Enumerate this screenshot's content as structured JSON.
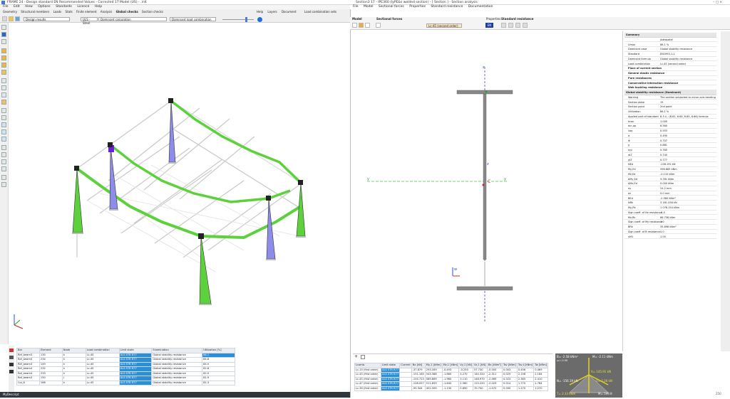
{
  "main_window": {
    "title": "FRAME 24 - Design standard EN Recommended Values - Corrected 17 Model (US) - .iri4",
    "menu": [
      "File",
      "Edit",
      "View",
      "Options",
      "Standards",
      "Licence",
      "Help"
    ],
    "tabs": [
      "Geometry",
      "Structural members",
      "Loads",
      "Stats",
      "Finite element",
      "Analysis",
      "Global checks",
      "Section checks"
    ],
    "right_tabs": [
      "Help",
      "Layers",
      "Document",
      "Load combination sets"
    ],
    "dropdown_design": "Design results",
    "dropdown_uls": "ULS - Steel",
    "dropdown_calc": "Dominant calculation",
    "dropdown_comb": "Dominant load combination"
  },
  "results_table": {
    "headers": [
      "Bar",
      "Element",
      "Node",
      "Load combination",
      "Limit state",
      "Examination",
      "Utilization [%]"
    ],
    "rows": [
      [
        "Raf_beam3",
        "130",
        "k",
        "Lc-45",
        "ULS STR R77",
        "Global stability resistance",
        "86.1"
      ],
      [
        "Raf_beam4",
        "234",
        "k",
        "Lc-45",
        "ULS STR R77",
        "Global stability resistance",
        "84.8"
      ],
      [
        "Raf_beam3",
        "149",
        "k",
        "Lc-45",
        "ULS STR R77",
        "Global stability resistance",
        "84.0"
      ],
      [
        "Raf_beam4",
        "232",
        "k",
        "Lc-45",
        "ULS STR R77",
        "Global stability resistance",
        "82.6"
      ],
      [
        "Raf_beam4",
        "233",
        "k",
        "Lc-45",
        "ULS STR R77",
        "Global stability resistance",
        "82.0"
      ],
      [
        "Raf_beam3",
        "150",
        "j",
        "Lc-45",
        "ULS STR R77",
        "Global stability resistance",
        "81.9"
      ],
      [
        "Col_6",
        "166",
        "k",
        "Lc-45",
        "ULS STR R77",
        "Global stability resistance",
        "81.3"
      ]
    ]
  },
  "statusbar": {
    "label": "MyDescript"
  },
  "section_window": {
    "title": "Section3 17 - IPE360 (IyPE&s welded section) - [ Section ] - Section analysis",
    "menu": [
      "File",
      "Model",
      "Sectional forces",
      "Properties",
      "Standard resistance",
      "Documentation"
    ],
    "tabs": [
      "Model",
      "Sectional forces",
      "Properties",
      "Standard resistance"
    ],
    "combo": "Lc-45 (second order)",
    "standard_button": "EN",
    "axis_labels": {
      "z_top": "z",
      "z_mid": "z",
      "y_left": "y",
      "y_right": "y",
      "centroid": "C",
      "w": "w"
    },
    "forces_table": {
      "headers": [
        "Lcomb.",
        "Limit state",
        "Current",
        "Nx [kN]",
        "My,1 [kNm]",
        "Mz,1 [kNm]",
        "Vy,1 [kN]",
        "Vz,1 [kN]",
        "Bx [kNm²]",
        "Tsv [kNm]",
        "Tsv,t [kNm]",
        "Tw [kNm]"
      ],
      "rows": [
        [
          "Lc-15 (first order)",
          "ULS STR R77",
          "",
          "-37.879",
          "293.349",
          "-0.493",
          "-0.250",
          "57.730",
          "-0.005",
          "0.003",
          "0.456",
          "0.469"
        ],
        [
          "Lc-45 (first order)",
          "ULS STR R77",
          "",
          "-151.185",
          "543.388",
          "-1.860",
          "3.270",
          "144.320",
          "-2.311",
          "0.025",
          "2.158",
          "2.184"
        ],
        [
          "Lc-45 (first order)",
          "ULS STR R77",
          "",
          "-154.723",
          "589.869",
          "-1.960",
          "3.110",
          "148.970",
          "-2.469",
          "0.023",
          "2.365",
          "2.410"
        ],
        [
          "Lc-47 (first order)",
          "ULS STR R77",
          "",
          "-128.057",
          "511.859",
          "-1.640",
          "2.560",
          "115.220",
          "-2.029",
          "0.014",
          "1.770",
          "1.784"
        ],
        [
          "Lc-39 (first order)",
          "ULS STR R77",
          "",
          "-95.344",
          "402.399",
          "-1.130",
          "0.690",
          "70.700",
          "-1.470",
          "0.000",
          "1.270",
          "1.270"
        ]
      ]
    },
    "stress_labels": {
      "tl": "B= -2.58 kNm²",
      "tl2": "ω=-0.50",
      "tr": "M= -2.11 kNm",
      "mid": "V= 145.91 kN",
      "left": "N= -156.19 kN",
      "right": "V= 2.26 kN",
      "bottom_left": "T= 2.33 kNm",
      "bottom_right": "M= 599.9"
    }
  },
  "summary_panel": {
    "summary_header": "Summary",
    "summary_rows": [
      [
        "",
        "Adequate!"
      ],
      [
        "Umax",
        "86.1 %"
      ],
      [
        "Dominant case",
        "Global stability resistance"
      ],
      [
        "Standard",
        "EN1993-1-1"
      ],
      [
        "Dominant formula",
        "Global stability resistance"
      ],
      [
        "Load combination",
        "Lc-45 (second order)"
      ]
    ],
    "collapsed_sections": [
      "Place of current section",
      "General elastic resistance",
      "Pure resistances",
      "Conservative interaction resistance",
      "Web buckling resistance"
    ],
    "gsr_header": "Global stability resistance (Dominant)",
    "gsr_rows": [
      [
        "Warning",
        "The section subjected to minor axis bending"
      ],
      [
        "Section plate",
        "15"
      ],
      [
        "Section point",
        "2nd point"
      ],
      [
        "Utilization",
        "86.1 %"
      ],
      [
        "Applied part of standard",
        "6.3.4 - (6.61, 6.64, 6.65, 6.66) formula"
      ],
      [
        "kcon",
        "1.000"
      ],
      [
        "αcr,op",
        "6.560"
      ],
      [
        "λop",
        "0.553"
      ],
      [
        "α",
        "0.490"
      ],
      [
        "Φ",
        "0.707"
      ],
      [
        "χ",
        "0.881"
      ],
      [
        "kyy",
        "0.760"
      ],
      [
        "αLT",
        "0.740"
      ],
      [
        "χLT",
        "0.777"
      ],
      [
        "NEd",
        "-156.192 kN"
      ],
      [
        "My,Ed",
        "598.685 kNm"
      ],
      [
        "Mz,Ed",
        "-2.110 kNm"
      ],
      [
        "ΔMy,Ed",
        "3.781 kNm"
      ],
      [
        "ΔMz,Ed",
        "0.000 kNm"
      ],
      [
        "ey",
        "24.2 mm"
      ],
      [
        "ez",
        "0.0 mm"
      ],
      [
        "BEd",
        "-2.580 kNm²"
      ],
      [
        "NRk",
        "3 181.058 kN"
      ],
      [
        "My,Rk",
        "1 076.154 kNm"
      ],
      [
        "Sign coeff. of Nx resistance",
        "-1.0"
      ],
      [
        "Mz,Rk",
        "86.738 kNm"
      ],
      [
        "Sign coeff. of My resistance",
        "1.0"
      ],
      [
        "BRk",
        "35.698 kNm²"
      ],
      [
        "Sign coeff. of B resistance",
        "1.0"
      ],
      [
        "γM1",
        "1.00"
      ]
    ]
  },
  "bottom_right_number": "250",
  "colors": {
    "accent": "#2b8fd6",
    "member_green": "#5cd13c",
    "member_blue": "#8d8ce8",
    "member_purple": "#6b1fd6"
  }
}
